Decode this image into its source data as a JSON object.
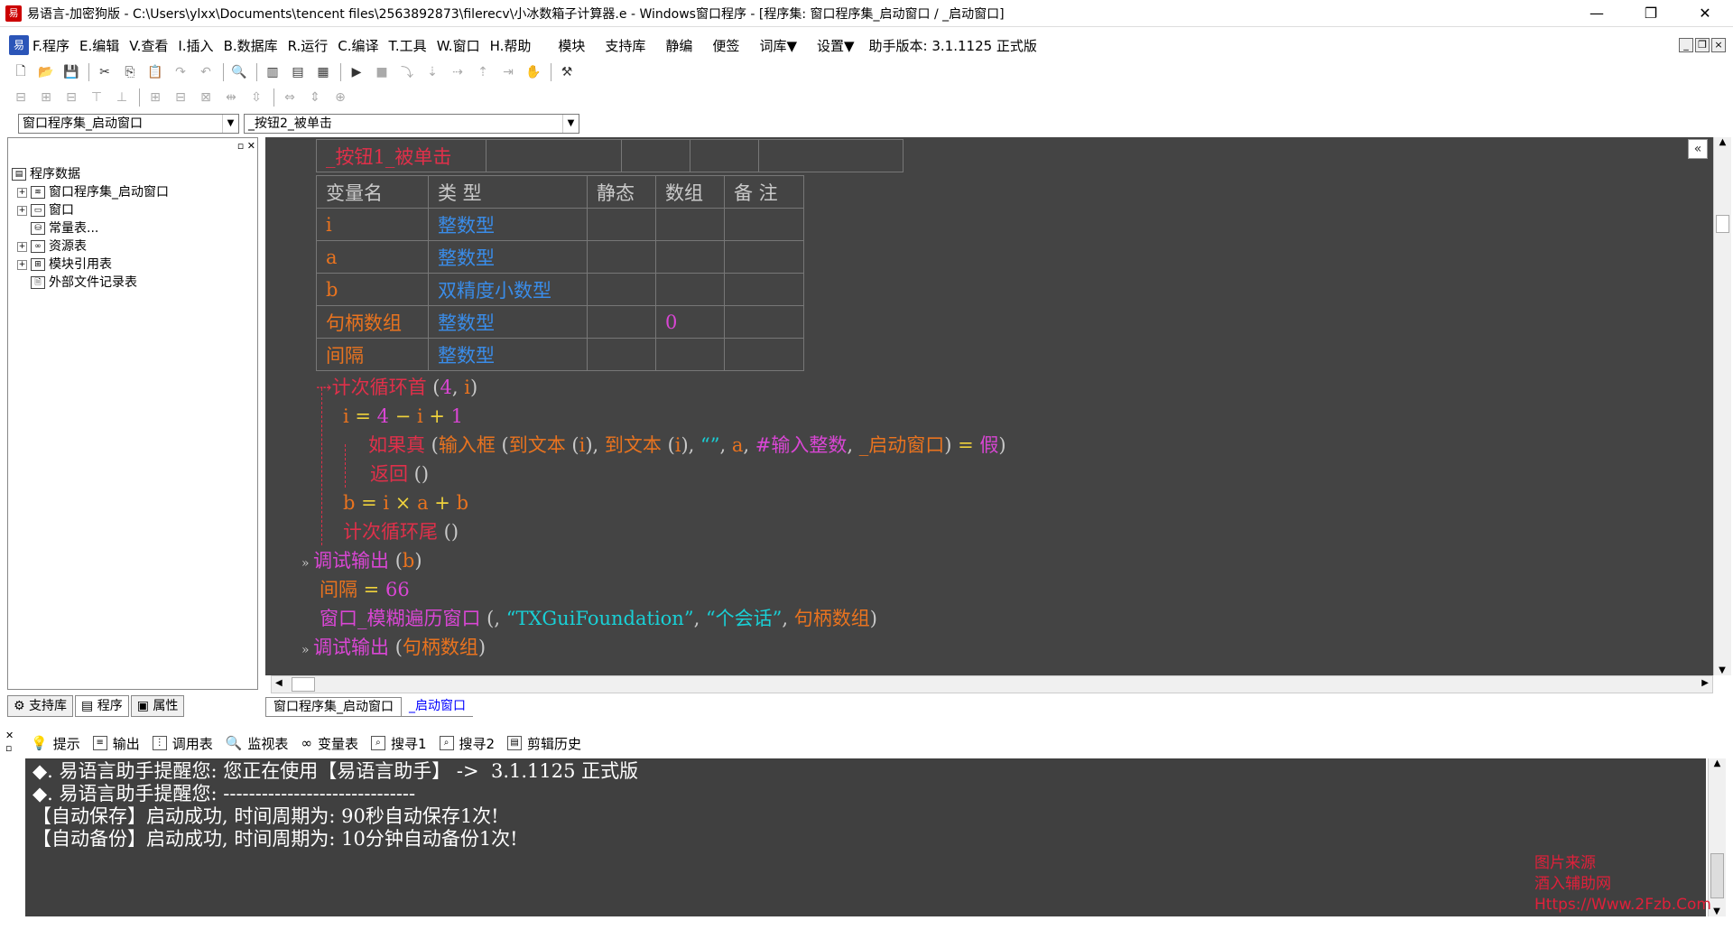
{
  "window": {
    "title": "易语言-加密狗版 - C:\\Users\\ylxx\\Documents\\tencent files\\2563892873\\filerecv\\小冰数箱子计算器.e - Windows窗口程序 - [程序集: 窗口程序集_启动窗口 / _启动窗口]",
    "minimize": "—",
    "restore": "❐",
    "close": "✕"
  },
  "menubar": {
    "items": [
      "F.程序",
      "E.编辑",
      "V.查看",
      "I.插入",
      "B.数据库",
      "R.运行",
      "C.编译",
      "T.工具",
      "W.窗口",
      "H.帮助"
    ],
    "extra": [
      "模块",
      "支持库",
      "静编",
      "便签",
      "词库▼",
      "设置▼"
    ],
    "version": "助手版本: 3.1.1125 正式版"
  },
  "combos": {
    "left": "窗口程序集_启动窗口",
    "right": "_按钮2_被单击"
  },
  "tree": {
    "root": "程序数据",
    "items": [
      "窗口程序集_启动窗口",
      "窗口",
      "常量表...",
      "资源表",
      "模块引用表",
      "外部文件记录表"
    ]
  },
  "left_tabs": [
    "支持库",
    "程序",
    "属性"
  ],
  "editor": {
    "sub_name": "_按钮1_被单击",
    "var_headers": [
      "变量名",
      "类 型",
      "静态",
      "数组",
      "备 注"
    ],
    "vars": [
      {
        "name": "i",
        "type": "整数型",
        "array": ""
      },
      {
        "name": "a",
        "type": "整数型",
        "array": ""
      },
      {
        "name": "b",
        "type": "双精度小数型",
        "array": ""
      },
      {
        "name": "句柄数组",
        "type": "整数型",
        "array": "0"
      },
      {
        "name": "间隔",
        "type": "整数型",
        "array": ""
      }
    ],
    "code": {
      "l1a": "计次循环首",
      "l1b": " (",
      "l1c": "4",
      "l1d": ", ",
      "l1e": "i",
      "l1f": ")",
      "l2": [
        "i",
        " = ",
        "4",
        " − ",
        "i",
        " + ",
        "1"
      ],
      "l3": [
        "如果真",
        " (",
        "输入框",
        " (",
        "到文本",
        " (",
        "i",
        "), ",
        "到文本",
        " (",
        "i",
        "), ",
        "“”",
        ", ",
        "a",
        ", ",
        "#输入整数",
        ", ",
        "_启动窗口",
        ") ",
        "=",
        " ",
        "假",
        ")"
      ],
      "l4": [
        "返回",
        " ()"
      ],
      "l5": [
        "b",
        " = ",
        "i",
        " × ",
        "a",
        " + ",
        "b"
      ],
      "l6": [
        "计次循环尾",
        " ()"
      ],
      "l7": [
        "调试输出",
        " (",
        "b",
        ")"
      ],
      "l8": [
        "间隔",
        " = ",
        "66"
      ],
      "l9": [
        "窗口_模糊遍历窗口",
        " (, ",
        "“TXGuiFoundation”",
        ", ",
        "“个会话”",
        ", ",
        "句柄数组",
        ")"
      ],
      "l10": [
        "调试输出",
        " (",
        "句柄数组",
        ")"
      ]
    }
  },
  "code_tabs": [
    "窗口程序集_启动窗口",
    "_启动窗口"
  ],
  "bottom_tabs": [
    "提示",
    "输出",
    "调用表",
    "监视表",
    "变量表",
    "搜寻1",
    "搜寻2",
    "剪辑历史"
  ],
  "output_lines": [
    "◆. 易语言助手提醒您: 您正在使用【易语言助手】 ->  3.1.1125 正式版",
    "◆. 易语言助手提醒您: ------------------------------",
    "【自动保存】启动成功, 时间周期为: 90秒自动保存1次!",
    "【自动备份】启动成功, 时间周期为: 10分钟自动备份1次!"
  ],
  "watermark": [
    "图片来源",
    "酒入辅助网",
    "Https://Www.2Fzb.Com"
  ]
}
